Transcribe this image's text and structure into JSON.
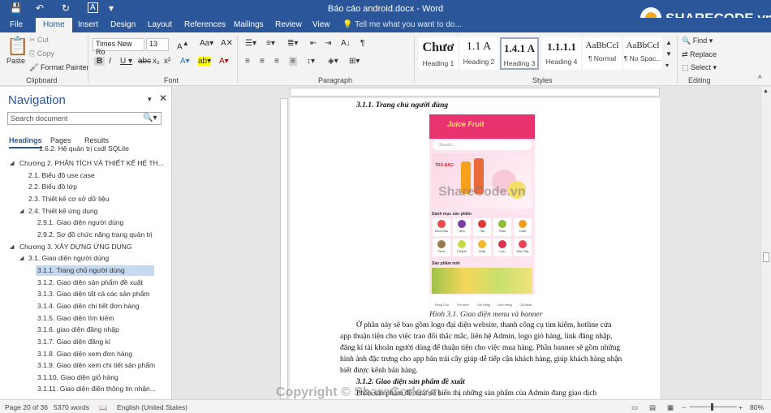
{
  "title": "Báo cáo android.docx  -  Word",
  "tabs": [
    "File",
    "Home",
    "Insert",
    "Design",
    "Layout",
    "References",
    "Mailings",
    "Review",
    "View"
  ],
  "tell_me": "Tell me what you want to do...",
  "clipboard": {
    "paste": "Paste",
    "cut": "Cut",
    "copy": "Copy",
    "format_painter": "Format Painter",
    "label": "Clipboard"
  },
  "font": {
    "name": "Times New Ro",
    "size": "13",
    "label": "Font"
  },
  "paragraph_label": "Paragraph",
  "styles": {
    "label": "Styles",
    "items": [
      {
        "sample": "Chươ",
        "name": "Heading 1"
      },
      {
        "sample": "1.1  A",
        "name": "Heading 2"
      },
      {
        "sample": "1.4.1 A",
        "name": "Heading 3"
      },
      {
        "sample": "1.1.1.1",
        "name": "Heading 4"
      },
      {
        "sample": "AaBbCcl",
        "name": "¶ Normal"
      },
      {
        "sample": "AaBbCcl",
        "name": "¶ No Spac..."
      }
    ]
  },
  "editing": {
    "find": "Find",
    "replace": "Replace",
    "select": "Select",
    "label": "Editing"
  },
  "nav": {
    "title": "Navigation",
    "search_placeholder": "Search document",
    "tabs": [
      "Headings",
      "Pages",
      "Results"
    ],
    "headings": [
      "1.6.2. Hệ quản trị csdl SQLite",
      "Chương 2. PHÂN TÍCH VÀ THIẾT KẾ HỆ TH...",
      "2.1. Biểu đồ use case",
      "2.2. Biểu đồ lớp",
      "2.3. Thiết kế cơ sở dữ liệu",
      "2.4. Thiết kế ứng dụng",
      "2.9.1. Giao diện người dùng",
      "2.9.2. Sơ đồ chức năng trang quản trị",
      "Chương 3. XÂY DỰNG ỨNG DỤNG",
      "3.1. Giao diện người dùng",
      "3.1.1. Trang chủ người dùng",
      "3.1.2. Giao diện sản phẩm đề xuất",
      "3.1.3. Giao diện tất cả các sản phẩm",
      "3.1.4. Giao diện chi tiết đơn hàng",
      "3.1.5. Giao diện tìm kiếm",
      "3.1.6. giao diện đăng nhập",
      "3.1.7. Giao diện đăng kí",
      "3.1.8. Giao diện xem đơn hàng",
      "3.1.9. Giao diện xem chi tiết sản phẩm",
      "3.1.10. Giao diện giỏ hàng",
      "3.1.11. Giao diện điền thông tin nhận..."
    ]
  },
  "doc": {
    "heading1": "3.1.1. Trang chủ người dùng",
    "caption": "Hình 3.1. Giao diện menu và banner",
    "para": [
      "Ở phần này sẽ bao gồm logo đại diện website, thanh công cụ tìm kiếm, hotline cửa",
      "app thuận tiện cho việc trao đổi thắc mắc, liên hệ Admin, logo giỏ hàng, link đăng nhập,",
      "đăng kí tài khoản người dùng để thuận tiện cho việc mua hàng. Phần banner sẽ gồm những",
      "hình ảnh đặc trưng cho app bán trái cây giúp dễ tiếp cận khách hàng, giúp khách hàng nhận",
      "biết được kênh bán hàng."
    ],
    "heading2": "3.1.2. Giao diện sản phẩm đề xuất",
    "last_line": "Phần sản phẩm đề xuất sẽ hiển thị những sản phẩm của Admin đang giao dịch",
    "phone": {
      "brand": "Juice Fruit",
      "search": "Search...",
      "banner": "TRÀ ĐÀO",
      "cat_title": "Danh mục sản phẩm",
      "cats": [
        "Dưa Hấu",
        "Nho",
        "Táo",
        "Kiwi",
        "Cam",
        "Dừa",
        "Chanh",
        "Xoài",
        "Lựu",
        "Dâu Tây"
      ],
      "new_title": "Sản phẩm mới",
      "bottom": [
        "Trang Chủ",
        "Tìm kiếm",
        "Giỏ Hàng",
        "Đơn Hàng",
        "Cá Nhân"
      ]
    }
  },
  "watermarks": [
    "ShareCode.vn",
    "Copyright © ShareCode.vn"
  ],
  "logo": "SHARECODE.vn",
  "status": {
    "page": "Page 20 of 36",
    "words": "5370 words",
    "lang": "English (United States)",
    "zoom": "80%"
  }
}
